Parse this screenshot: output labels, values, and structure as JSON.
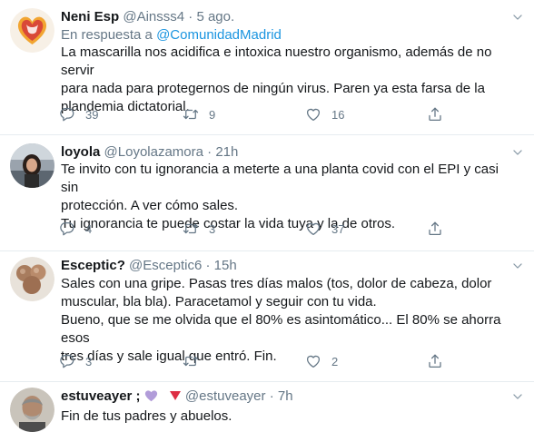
{
  "tweets": [
    {
      "name": "Neni Esp",
      "handle": "@Ainsss4",
      "sep": "·",
      "time": "5 ago.",
      "reply_prefix": "En respuesta a ",
      "reply_to": "@ComunidadMadrid",
      "lines": [
        "La mascarilla nos acidifica e intoxica nuestro organismo, además de no servir",
        "para nada para protegernos de ningún virus. Paren ya esta farsa de la",
        "plandemia dictatorial."
      ],
      "replies": "39",
      "retweets": "9",
      "likes": "16"
    },
    {
      "name": "loyola",
      "handle": "@Loyolazamora",
      "sep": "·",
      "time": "21h",
      "lines": [
        "Te invito con tu ignorancia a meterte a una planta covid con el EPI y casi sin",
        "protección. A ver cómo sales.",
        "Tu ignorancia te puede costar la vida tuya y la de otros."
      ],
      "replies": "4",
      "retweets": "3",
      "likes": "37"
    },
    {
      "name": "Esceptic?",
      "handle": "@Esceptic6",
      "sep": "·",
      "time": "15h",
      "lines": [
        "Sales con una gripe. Pasas tres días malos (tos, dolor de cabeza, dolor",
        "muscular, bla bla). Paracetamol y seguir con tu vida.",
        "Bueno, que se me olvida que el 80% es asintomático... El 80% se ahorra esos",
        "tres días y sale igual que entró. Fin."
      ],
      "replies": "3",
      "retweets": "",
      "likes": "2"
    },
    {
      "name": "estuveayer ;",
      "handle": "@estuveayer",
      "sep": "·",
      "time": "7h",
      "lines": [
        "Fin de tus padres y abuelos."
      ]
    }
  ],
  "colors": {
    "text": "#14171a",
    "secondary": "#657786",
    "link": "#1b95e0",
    "divider": "#e6ecf0",
    "emoji_heart": "#b19cd9",
    "emoji_triangle": "#dd2e44"
  },
  "icons": [
    "reply-icon",
    "retweet-icon",
    "like-icon",
    "share-icon",
    "caret-down-icon",
    "purple-heart-icon",
    "red-triangle-icon"
  ]
}
